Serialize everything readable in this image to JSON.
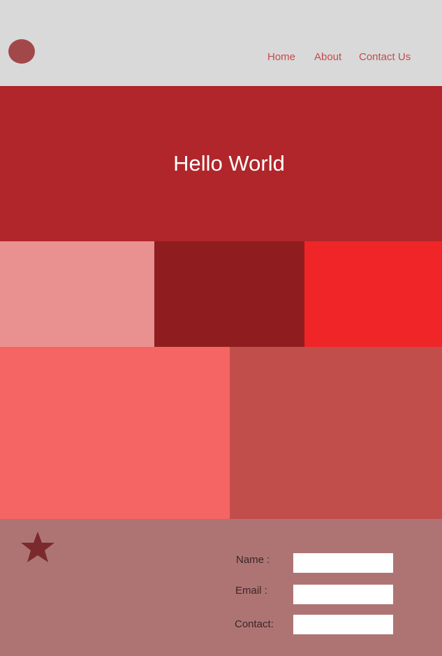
{
  "header": {
    "nav": {
      "home": "Home",
      "about": "About",
      "contact": "Contact Us"
    }
  },
  "hero": {
    "title": "Hello World"
  },
  "tiles": {
    "row1": [
      "#e89190",
      "#8f1d1f",
      "#ef2527"
    ],
    "row2": [
      "#f56564",
      "#c24e4c"
    ]
  },
  "footer": {
    "icon": "star-icon",
    "form": {
      "name_label": "Name :",
      "email_label": "Email :",
      "contact_label": "Contact:",
      "name_value": "",
      "email_value": "",
      "contact_value": ""
    }
  },
  "colors": {
    "header_bg": "#d9d9d9",
    "logo": "#a2484a",
    "nav_link": "#c8494b",
    "hero_bg": "#b0262a",
    "footer_bg": "#ae7474",
    "star": "#7a2a2c"
  }
}
